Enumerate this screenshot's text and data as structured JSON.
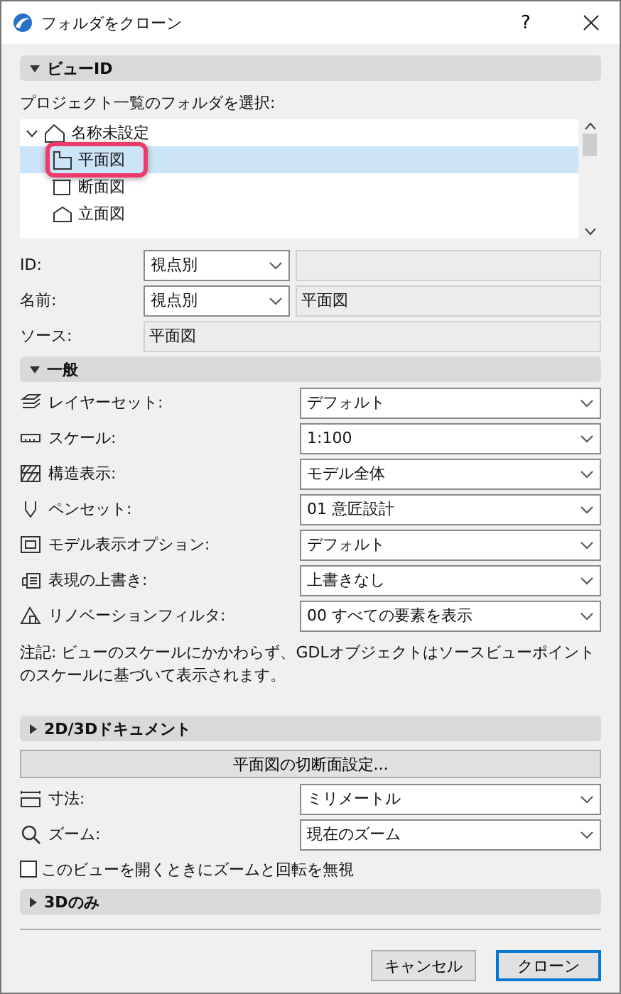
{
  "window": {
    "title": "フォルダをクローン",
    "help": "?"
  },
  "view_id": {
    "header": "ビューID",
    "expanded": true,
    "folder_label": "プロジェクト一覧のフォルダを選択:",
    "tree": [
      {
        "label": "名称未設定",
        "expanded": true,
        "selected": false,
        "children": [
          {
            "label": "平面図",
            "selected": true,
            "highlighted": true
          },
          {
            "label": "断面図",
            "selected": false,
            "highlighted": false
          },
          {
            "label": "立面図",
            "selected": false,
            "highlighted": false
          }
        ]
      }
    ],
    "id": {
      "label": "ID:",
      "mode": "視点別"
    },
    "name": {
      "label": "名前:",
      "mode": "視点別",
      "value": "平面図"
    },
    "source": {
      "label": "ソース:",
      "value": "平面図"
    }
  },
  "general": {
    "header": "一般",
    "expanded": true,
    "settings": [
      {
        "label": "レイヤーセット:",
        "value": "デフォルト"
      },
      {
        "label": "スケール:",
        "value": "1:100"
      },
      {
        "label": "構造表示:",
        "value": "モデル全体"
      },
      {
        "label": "ペンセット:",
        "value": "01 意匠設計"
      },
      {
        "label": "モデル表示オプション:",
        "value": "デフォルト"
      },
      {
        "label": "表現の上書き:",
        "value": "上書きなし"
      },
      {
        "label": "リノベーションフィルタ:",
        "value": "00 すべての要素を表示"
      }
    ],
    "note": "注記: ビューのスケールにかかわらず、GDLオブジェクトはソースビューポイントのスケールに基づいて表示されます。"
  },
  "documents": {
    "header": "2D/3Dドキュメント",
    "expanded": false,
    "cut_plane_button": "平面図の切断面設定...",
    "settings": [
      {
        "label": "寸法:",
        "value": "ミリメートル"
      },
      {
        "label": "ズーム:",
        "value": "現在のズーム"
      }
    ],
    "ignore_zoom": {
      "label": "このビューを開くときにズームと回転を無視",
      "checked": false
    }
  },
  "three_d": {
    "header": "3Dのみ",
    "expanded": false
  },
  "buttons": [
    {
      "label": "キャンセル",
      "default": false
    },
    {
      "label": "クローン",
      "default": true
    }
  ]
}
